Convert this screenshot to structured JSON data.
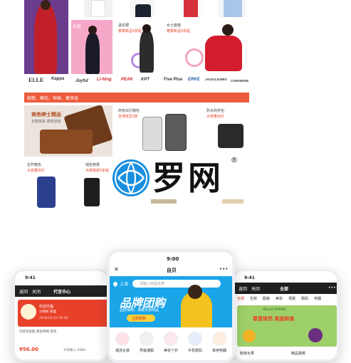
{
  "brands": [
    "ELLE",
    "Kappa",
    "Joyful",
    "Li-Ning",
    "PEAK",
    "KPT",
    "Five Plus",
    "ERKE",
    "JACK&JONES",
    "CONVERSE"
  ],
  "tile_texts": {
    "purple_tag": "女装",
    "center_caption_1": "温衣裙",
    "center_caption_2": "春季新品5折起",
    "right_caption_1": "女士套装",
    "right_caption_2": "春季新品5折起"
  },
  "category_bar": "鞋靴、箱包、钟表、奢侈品",
  "bags": {
    "leather_title": "商务绅士精品",
    "leather_sub": "长款钱夹 柔软舒适",
    "luggage_caption_1": "商务出行箱包",
    "luggage_caption_2": "全场低至3折",
    "right_caption_1": "防水商务包",
    "right_caption_2": "大容量出行",
    "bottom_left_1": "拉杆箱包",
    "bottom_left_2": "大容量出行",
    "bottom_mid_1": "钱包特惠",
    "bottom_mid_2": "大牌真皮5折起"
  },
  "watermark": {
    "text": "罗网",
    "mark": "®"
  },
  "phone_left": {
    "time": "9:41",
    "back": "返回",
    "close": "关闭",
    "title": "代言中心",
    "greeting": "欢迎光临",
    "sub": "分销商 管理",
    "date": "2018-01-02 05:00",
    "note": "可提现金额 佣金明细 提现",
    "amount": "¥56.00",
    "today": "今日收入 2080"
  },
  "phone_center": {
    "time": "9:00",
    "close": "✕",
    "title": "自贝",
    "more": "•••",
    "city": "上海",
    "search_placeholder": "请输入商品名称",
    "banner_title": "品牌团购",
    "banner_sub": "品质保障，海量实惠商品",
    "banner_btn": "立即抢购",
    "icons": [
      "潮流女装",
      "男装潮服",
      "美妆个护",
      "手机数码",
      "家用电器"
    ]
  },
  "phone_right": {
    "time": "9:41",
    "back": "返回",
    "close": "关闭",
    "title": "全部",
    "more": "•••",
    "tabs": [
      "全部",
      "生鲜",
      "服装",
      "美妆",
      "母婴",
      "数码",
      "电器"
    ],
    "banner_small": "HELLO SPRING",
    "banner_title": "春意焕然 美丽鲜美",
    "row_labels": [
      "新鲜水果",
      "精品蔬菜"
    ]
  },
  "colors": {
    "accent": "#e8412a",
    "banner_blue": "#1aa5e8",
    "dark_nav": "#222222"
  }
}
